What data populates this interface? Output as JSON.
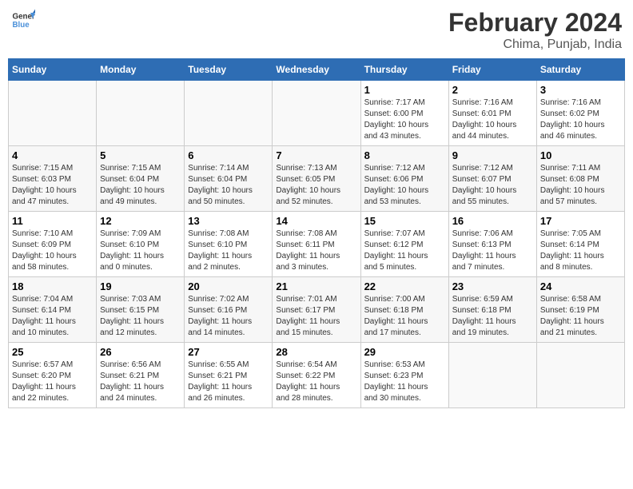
{
  "header": {
    "logo_general": "General",
    "logo_blue": "Blue",
    "title": "February 2024",
    "subtitle": "Chima, Punjab, India"
  },
  "calendar": {
    "days_of_week": [
      "Sunday",
      "Monday",
      "Tuesday",
      "Wednesday",
      "Thursday",
      "Friday",
      "Saturday"
    ],
    "weeks": [
      [
        {
          "date": "",
          "info": ""
        },
        {
          "date": "",
          "info": ""
        },
        {
          "date": "",
          "info": ""
        },
        {
          "date": "",
          "info": ""
        },
        {
          "date": "1",
          "info": "Sunrise: 7:17 AM\nSunset: 6:00 PM\nDaylight: 10 hours\nand 43 minutes."
        },
        {
          "date": "2",
          "info": "Sunrise: 7:16 AM\nSunset: 6:01 PM\nDaylight: 10 hours\nand 44 minutes."
        },
        {
          "date": "3",
          "info": "Sunrise: 7:16 AM\nSunset: 6:02 PM\nDaylight: 10 hours\nand 46 minutes."
        }
      ],
      [
        {
          "date": "4",
          "info": "Sunrise: 7:15 AM\nSunset: 6:03 PM\nDaylight: 10 hours\nand 47 minutes."
        },
        {
          "date": "5",
          "info": "Sunrise: 7:15 AM\nSunset: 6:04 PM\nDaylight: 10 hours\nand 49 minutes."
        },
        {
          "date": "6",
          "info": "Sunrise: 7:14 AM\nSunset: 6:04 PM\nDaylight: 10 hours\nand 50 minutes."
        },
        {
          "date": "7",
          "info": "Sunrise: 7:13 AM\nSunset: 6:05 PM\nDaylight: 10 hours\nand 52 minutes."
        },
        {
          "date": "8",
          "info": "Sunrise: 7:12 AM\nSunset: 6:06 PM\nDaylight: 10 hours\nand 53 minutes."
        },
        {
          "date": "9",
          "info": "Sunrise: 7:12 AM\nSunset: 6:07 PM\nDaylight: 10 hours\nand 55 minutes."
        },
        {
          "date": "10",
          "info": "Sunrise: 7:11 AM\nSunset: 6:08 PM\nDaylight: 10 hours\nand 57 minutes."
        }
      ],
      [
        {
          "date": "11",
          "info": "Sunrise: 7:10 AM\nSunset: 6:09 PM\nDaylight: 10 hours\nand 58 minutes."
        },
        {
          "date": "12",
          "info": "Sunrise: 7:09 AM\nSunset: 6:10 PM\nDaylight: 11 hours\nand 0 minutes."
        },
        {
          "date": "13",
          "info": "Sunrise: 7:08 AM\nSunset: 6:10 PM\nDaylight: 11 hours\nand 2 minutes."
        },
        {
          "date": "14",
          "info": "Sunrise: 7:08 AM\nSunset: 6:11 PM\nDaylight: 11 hours\nand 3 minutes."
        },
        {
          "date": "15",
          "info": "Sunrise: 7:07 AM\nSunset: 6:12 PM\nDaylight: 11 hours\nand 5 minutes."
        },
        {
          "date": "16",
          "info": "Sunrise: 7:06 AM\nSunset: 6:13 PM\nDaylight: 11 hours\nand 7 minutes."
        },
        {
          "date": "17",
          "info": "Sunrise: 7:05 AM\nSunset: 6:14 PM\nDaylight: 11 hours\nand 8 minutes."
        }
      ],
      [
        {
          "date": "18",
          "info": "Sunrise: 7:04 AM\nSunset: 6:14 PM\nDaylight: 11 hours\nand 10 minutes."
        },
        {
          "date": "19",
          "info": "Sunrise: 7:03 AM\nSunset: 6:15 PM\nDaylight: 11 hours\nand 12 minutes."
        },
        {
          "date": "20",
          "info": "Sunrise: 7:02 AM\nSunset: 6:16 PM\nDaylight: 11 hours\nand 14 minutes."
        },
        {
          "date": "21",
          "info": "Sunrise: 7:01 AM\nSunset: 6:17 PM\nDaylight: 11 hours\nand 15 minutes."
        },
        {
          "date": "22",
          "info": "Sunrise: 7:00 AM\nSunset: 6:18 PM\nDaylight: 11 hours\nand 17 minutes."
        },
        {
          "date": "23",
          "info": "Sunrise: 6:59 AM\nSunset: 6:18 PM\nDaylight: 11 hours\nand 19 minutes."
        },
        {
          "date": "24",
          "info": "Sunrise: 6:58 AM\nSunset: 6:19 PM\nDaylight: 11 hours\nand 21 minutes."
        }
      ],
      [
        {
          "date": "25",
          "info": "Sunrise: 6:57 AM\nSunset: 6:20 PM\nDaylight: 11 hours\nand 22 minutes."
        },
        {
          "date": "26",
          "info": "Sunrise: 6:56 AM\nSunset: 6:21 PM\nDaylight: 11 hours\nand 24 minutes."
        },
        {
          "date": "27",
          "info": "Sunrise: 6:55 AM\nSunset: 6:21 PM\nDaylight: 11 hours\nand 26 minutes."
        },
        {
          "date": "28",
          "info": "Sunrise: 6:54 AM\nSunset: 6:22 PM\nDaylight: 11 hours\nand 28 minutes."
        },
        {
          "date": "29",
          "info": "Sunrise: 6:53 AM\nSunset: 6:23 PM\nDaylight: 11 hours\nand 30 minutes."
        },
        {
          "date": "",
          "info": ""
        },
        {
          "date": "",
          "info": ""
        }
      ]
    ]
  }
}
